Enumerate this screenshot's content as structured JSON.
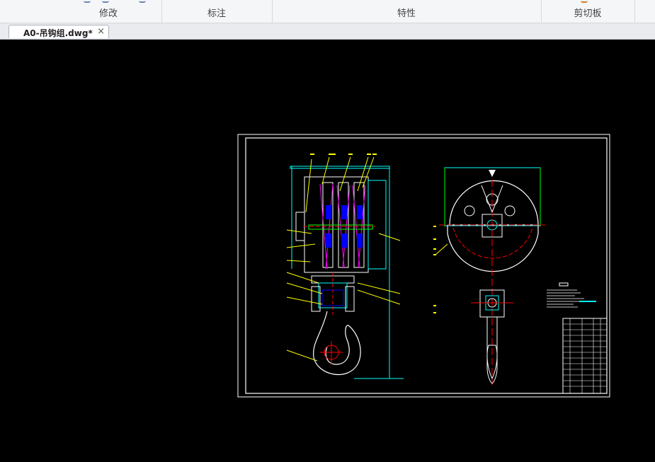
{
  "ribbon": {
    "groups": [
      {
        "label": "修改"
      },
      {
        "label": "标注"
      },
      {
        "label": "特性"
      },
      {
        "label": "剪切板"
      }
    ]
  },
  "document_tab": {
    "label": "A0-吊钩组.dwg*",
    "close": "×"
  },
  "colors": {
    "canvas": "#000000",
    "frame": "#ffffff",
    "line_yellow": "#ffff00",
    "line_cyan": "#00ffff",
    "line_green": "#00ff00",
    "line_red": "#ff0000",
    "line_blue": "#0000ff",
    "line_magenta": "#ff00ff"
  }
}
